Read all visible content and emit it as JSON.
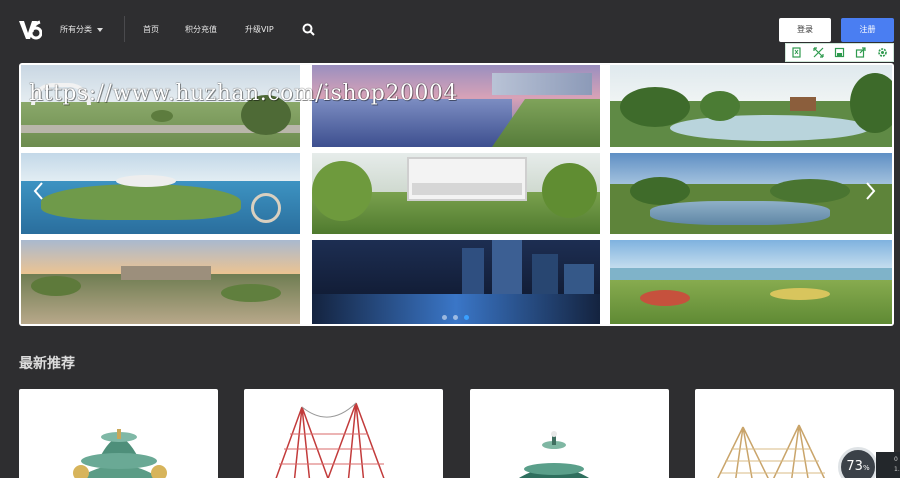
{
  "header": {
    "logo_text": "V6",
    "nav": {
      "category_label": "所有分类",
      "home_label": "首页",
      "points_label": "积分充值",
      "vip_label": "升级VIP"
    },
    "search_icon": "search-icon",
    "login_label": "登录",
    "register_label": "注册"
  },
  "toolbar": {
    "icons": [
      "bookmark-icon",
      "fullscreen-icon",
      "save-icon",
      "share-icon",
      "settings-icon"
    ],
    "color": "#2e9a4e"
  },
  "banner": {
    "watermark": "https://www.huzhan.com/ishop20004",
    "slide_count": 3,
    "active_slide": 3,
    "prev_icon": "chevron-left-icon",
    "next_icon": "chevron-right-icon"
  },
  "section": {
    "title": "最新推荐"
  },
  "speed_widget": {
    "percent": "73",
    "unit": "%",
    "side_line1": "0",
    "side_line2": "1.5"
  },
  "colors": {
    "background": "#2e2e30",
    "accent": "#4a7ef2",
    "active_dot": "#3aa0ff"
  }
}
